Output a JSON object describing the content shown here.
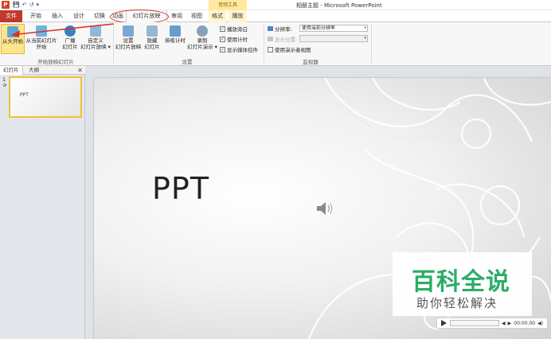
{
  "window": {
    "title": "相册主题 - Microsoft PowerPoint",
    "context_tab_group": "音频工具",
    "app_icon_letter": "P"
  },
  "quick_access": {
    "save": "💾",
    "undo": "↶",
    "redo": "↺",
    "more": "▾"
  },
  "tabs": [
    {
      "label": "文件"
    },
    {
      "label": "开始"
    },
    {
      "label": "插入"
    },
    {
      "label": "设计"
    },
    {
      "label": "切换"
    },
    {
      "label": "动画"
    },
    {
      "label": "幻灯片放映"
    },
    {
      "label": "审阅"
    },
    {
      "label": "视图"
    },
    {
      "label": "格式"
    },
    {
      "label": "播放"
    }
  ],
  "ribbon": {
    "start_group": {
      "label": "开始放映幻灯片",
      "from_beginning": "从头开始",
      "from_current_1": "从当前幻灯片",
      "from_current_2": "开始",
      "broadcast_1": "广播",
      "broadcast_2": "幻灯片",
      "custom_1": "自定义",
      "custom_2": "幻灯片放映 ▾"
    },
    "setup_group": {
      "label": "设置",
      "setup_1": "设置",
      "setup_2": "幻灯片放映",
      "hide_1": "隐藏",
      "hide_2": "幻灯片",
      "rehearse": "排练计时",
      "record_1": "录制",
      "record_2": "幻灯片演示 ▾",
      "play_narration": "播放旁白",
      "use_timings": "使用计时",
      "show_media": "显示媒体控件",
      "check_mark": "✓"
    },
    "monitor_group": {
      "label": "监视器",
      "resolution_label": "分辨率:",
      "resolution_value": "使用当前分辨率",
      "show_on_label": "显示位置:",
      "presenter_view": "使用演示者视图"
    }
  },
  "panel": {
    "tab_slides": "幻灯片",
    "tab_outline": "大纲",
    "close": "✕",
    "slide_number": "1",
    "slide_star": "✰",
    "thumb_title": "PPT"
  },
  "slide": {
    "title": "PPT"
  },
  "player": {
    "time": "00:00.00",
    "volume": "◀)"
  },
  "watermark": {
    "main": "百科全说",
    "sub": "助你轻松解决"
  },
  "colors": {
    "file_tab": "#c0392b",
    "highlight": "#d9332b",
    "watermark": "#2aae67",
    "selected": "#fce58b"
  }
}
